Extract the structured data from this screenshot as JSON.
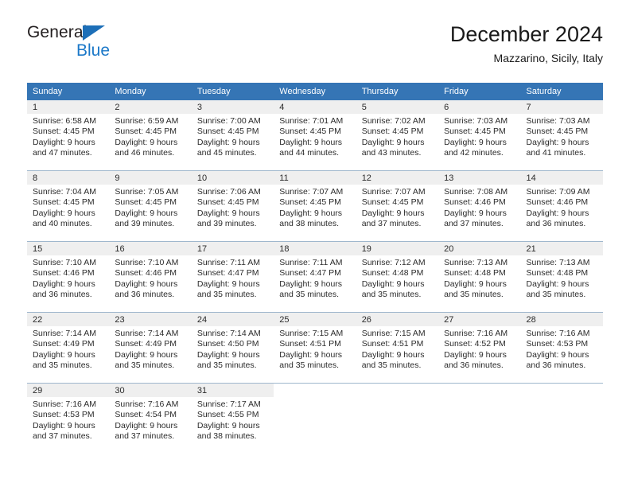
{
  "brand": {
    "name_dark": "General",
    "name_blue": "Blue",
    "triangle_color": "#1d6fb8",
    "blue_color": "#1b78c8"
  },
  "header": {
    "title": "December 2024",
    "subtitle": "Mazzarino, Sicily, Italy"
  },
  "colors": {
    "header_row_bg": "#3575b5",
    "header_row_text": "#ffffff",
    "daynum_band_bg": "#efefef",
    "grid_line": "#9fb7cd"
  },
  "calendar": {
    "weekday_headers": [
      "Sunday",
      "Monday",
      "Tuesday",
      "Wednesday",
      "Thursday",
      "Friday",
      "Saturday"
    ],
    "weeks": [
      [
        {
          "day": "1",
          "sunrise": "Sunrise: 6:58 AM",
          "sunset": "Sunset: 4:45 PM",
          "daylight1": "Daylight: 9 hours",
          "daylight2": "and 47 minutes."
        },
        {
          "day": "2",
          "sunrise": "Sunrise: 6:59 AM",
          "sunset": "Sunset: 4:45 PM",
          "daylight1": "Daylight: 9 hours",
          "daylight2": "and 46 minutes."
        },
        {
          "day": "3",
          "sunrise": "Sunrise: 7:00 AM",
          "sunset": "Sunset: 4:45 PM",
          "daylight1": "Daylight: 9 hours",
          "daylight2": "and 45 minutes."
        },
        {
          "day": "4",
          "sunrise": "Sunrise: 7:01 AM",
          "sunset": "Sunset: 4:45 PM",
          "daylight1": "Daylight: 9 hours",
          "daylight2": "and 44 minutes."
        },
        {
          "day": "5",
          "sunrise": "Sunrise: 7:02 AM",
          "sunset": "Sunset: 4:45 PM",
          "daylight1": "Daylight: 9 hours",
          "daylight2": "and 43 minutes."
        },
        {
          "day": "6",
          "sunrise": "Sunrise: 7:03 AM",
          "sunset": "Sunset: 4:45 PM",
          "daylight1": "Daylight: 9 hours",
          "daylight2": "and 42 minutes."
        },
        {
          "day": "7",
          "sunrise": "Sunrise: 7:03 AM",
          "sunset": "Sunset: 4:45 PM",
          "daylight1": "Daylight: 9 hours",
          "daylight2": "and 41 minutes."
        }
      ],
      [
        {
          "day": "8",
          "sunrise": "Sunrise: 7:04 AM",
          "sunset": "Sunset: 4:45 PM",
          "daylight1": "Daylight: 9 hours",
          "daylight2": "and 40 minutes."
        },
        {
          "day": "9",
          "sunrise": "Sunrise: 7:05 AM",
          "sunset": "Sunset: 4:45 PM",
          "daylight1": "Daylight: 9 hours",
          "daylight2": "and 39 minutes."
        },
        {
          "day": "10",
          "sunrise": "Sunrise: 7:06 AM",
          "sunset": "Sunset: 4:45 PM",
          "daylight1": "Daylight: 9 hours",
          "daylight2": "and 39 minutes."
        },
        {
          "day": "11",
          "sunrise": "Sunrise: 7:07 AM",
          "sunset": "Sunset: 4:45 PM",
          "daylight1": "Daylight: 9 hours",
          "daylight2": "and 38 minutes."
        },
        {
          "day": "12",
          "sunrise": "Sunrise: 7:07 AM",
          "sunset": "Sunset: 4:45 PM",
          "daylight1": "Daylight: 9 hours",
          "daylight2": "and 37 minutes."
        },
        {
          "day": "13",
          "sunrise": "Sunrise: 7:08 AM",
          "sunset": "Sunset: 4:46 PM",
          "daylight1": "Daylight: 9 hours",
          "daylight2": "and 37 minutes."
        },
        {
          "day": "14",
          "sunrise": "Sunrise: 7:09 AM",
          "sunset": "Sunset: 4:46 PM",
          "daylight1": "Daylight: 9 hours",
          "daylight2": "and 36 minutes."
        }
      ],
      [
        {
          "day": "15",
          "sunrise": "Sunrise: 7:10 AM",
          "sunset": "Sunset: 4:46 PM",
          "daylight1": "Daylight: 9 hours",
          "daylight2": "and 36 minutes."
        },
        {
          "day": "16",
          "sunrise": "Sunrise: 7:10 AM",
          "sunset": "Sunset: 4:46 PM",
          "daylight1": "Daylight: 9 hours",
          "daylight2": "and 36 minutes."
        },
        {
          "day": "17",
          "sunrise": "Sunrise: 7:11 AM",
          "sunset": "Sunset: 4:47 PM",
          "daylight1": "Daylight: 9 hours",
          "daylight2": "and 35 minutes."
        },
        {
          "day": "18",
          "sunrise": "Sunrise: 7:11 AM",
          "sunset": "Sunset: 4:47 PM",
          "daylight1": "Daylight: 9 hours",
          "daylight2": "and 35 minutes."
        },
        {
          "day": "19",
          "sunrise": "Sunrise: 7:12 AM",
          "sunset": "Sunset: 4:48 PM",
          "daylight1": "Daylight: 9 hours",
          "daylight2": "and 35 minutes."
        },
        {
          "day": "20",
          "sunrise": "Sunrise: 7:13 AM",
          "sunset": "Sunset: 4:48 PM",
          "daylight1": "Daylight: 9 hours",
          "daylight2": "and 35 minutes."
        },
        {
          "day": "21",
          "sunrise": "Sunrise: 7:13 AM",
          "sunset": "Sunset: 4:48 PM",
          "daylight1": "Daylight: 9 hours",
          "daylight2": "and 35 minutes."
        }
      ],
      [
        {
          "day": "22",
          "sunrise": "Sunrise: 7:14 AM",
          "sunset": "Sunset: 4:49 PM",
          "daylight1": "Daylight: 9 hours",
          "daylight2": "and 35 minutes."
        },
        {
          "day": "23",
          "sunrise": "Sunrise: 7:14 AM",
          "sunset": "Sunset: 4:49 PM",
          "daylight1": "Daylight: 9 hours",
          "daylight2": "and 35 minutes."
        },
        {
          "day": "24",
          "sunrise": "Sunrise: 7:14 AM",
          "sunset": "Sunset: 4:50 PM",
          "daylight1": "Daylight: 9 hours",
          "daylight2": "and 35 minutes."
        },
        {
          "day": "25",
          "sunrise": "Sunrise: 7:15 AM",
          "sunset": "Sunset: 4:51 PM",
          "daylight1": "Daylight: 9 hours",
          "daylight2": "and 35 minutes."
        },
        {
          "day": "26",
          "sunrise": "Sunrise: 7:15 AM",
          "sunset": "Sunset: 4:51 PM",
          "daylight1": "Daylight: 9 hours",
          "daylight2": "and 35 minutes."
        },
        {
          "day": "27",
          "sunrise": "Sunrise: 7:16 AM",
          "sunset": "Sunset: 4:52 PM",
          "daylight1": "Daylight: 9 hours",
          "daylight2": "and 36 minutes."
        },
        {
          "day": "28",
          "sunrise": "Sunrise: 7:16 AM",
          "sunset": "Sunset: 4:53 PM",
          "daylight1": "Daylight: 9 hours",
          "daylight2": "and 36 minutes."
        }
      ],
      [
        {
          "day": "29",
          "sunrise": "Sunrise: 7:16 AM",
          "sunset": "Sunset: 4:53 PM",
          "daylight1": "Daylight: 9 hours",
          "daylight2": "and 37 minutes."
        },
        {
          "day": "30",
          "sunrise": "Sunrise: 7:16 AM",
          "sunset": "Sunset: 4:54 PM",
          "daylight1": "Daylight: 9 hours",
          "daylight2": "and 37 minutes."
        },
        {
          "day": "31",
          "sunrise": "Sunrise: 7:17 AM",
          "sunset": "Sunset: 4:55 PM",
          "daylight1": "Daylight: 9 hours",
          "daylight2": "and 38 minutes."
        },
        {
          "day": "",
          "sunrise": "",
          "sunset": "",
          "daylight1": "",
          "daylight2": ""
        },
        {
          "day": "",
          "sunrise": "",
          "sunset": "",
          "daylight1": "",
          "daylight2": ""
        },
        {
          "day": "",
          "sunrise": "",
          "sunset": "",
          "daylight1": "",
          "daylight2": ""
        },
        {
          "day": "",
          "sunrise": "",
          "sunset": "",
          "daylight1": "",
          "daylight2": ""
        }
      ]
    ]
  }
}
